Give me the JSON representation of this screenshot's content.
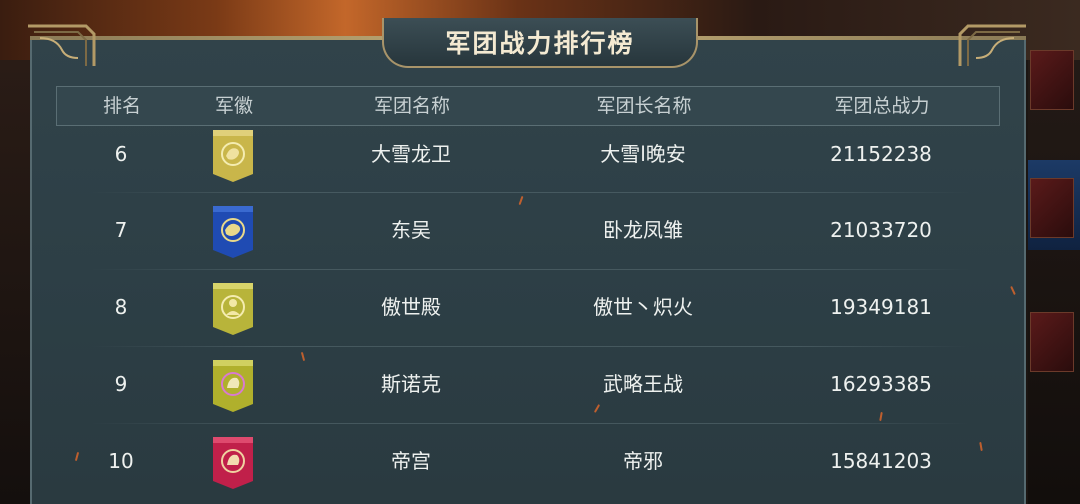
{
  "title": "军团战力排行榜",
  "columns": {
    "rank": "排名",
    "badge": "军徽",
    "name": "军团名称",
    "leader": "军团长名称",
    "power": "军团总战力"
  },
  "rows": [
    {
      "rank": "6",
      "badge_icon": "dragon-emblem-gold",
      "badge_color": "#c9b64a",
      "name": "大雪龙卫",
      "leader": "大雪l晚安",
      "power": "21152238"
    },
    {
      "rank": "7",
      "badge_icon": "dragon-emblem-blue",
      "badge_color": "#1f4bb3",
      "name": "东吴",
      "leader": "卧龙凤雏",
      "power": "21033720"
    },
    {
      "rank": "8",
      "badge_icon": "deity-emblem-gold",
      "badge_color": "#b8b43a",
      "name": "傲世殿",
      "leader": "傲世丶炽火",
      "power": "19349181"
    },
    {
      "rank": "9",
      "badge_icon": "beast-emblem-gold",
      "badge_color": "#b0b02c",
      "name": "斯诺克",
      "leader": "武略王战",
      "power": "16293385"
    },
    {
      "rank": "10",
      "badge_icon": "beast-emblem-red",
      "badge_color": "#c0204a",
      "name": "帝宫",
      "leader": "帝邪",
      "power": "15841203"
    }
  ]
}
